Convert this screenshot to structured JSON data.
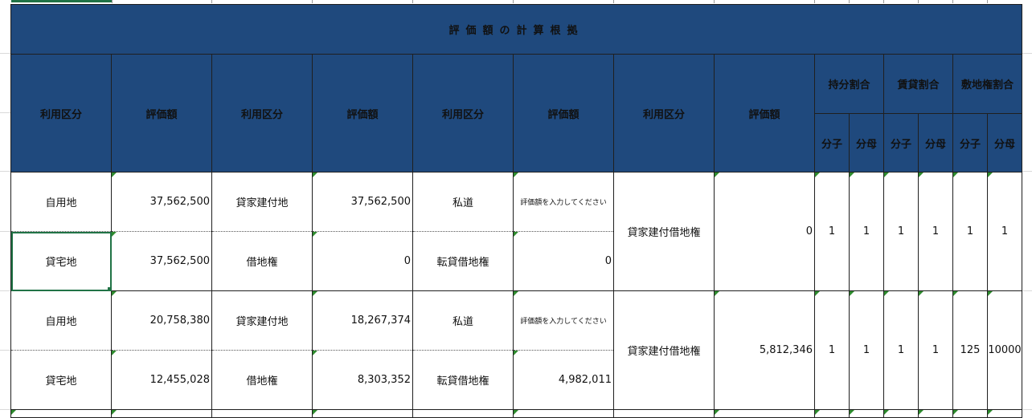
{
  "sheet": {
    "title": "評価額の計算根拠",
    "headers": {
      "col1": "利用区分",
      "col2": "評価額",
      "col3": "利用区分",
      "col4": "評価額",
      "col5": "利用区分",
      "col6": "評価額",
      "col7": "利用区分",
      "col8": "評価額",
      "group_share": "持分割合",
      "group_lease": "賃貸割合",
      "group_land": "敷地権割合",
      "numer": "分子",
      "denom": "分母"
    },
    "blocks": [
      {
        "top": {
          "use1": "自用地",
          "val1": "37,562,500",
          "use2": "貸家建付地",
          "val2": "37,562,500",
          "use3": "私道",
          "val3": "評価額を入力してください"
        },
        "bottom": {
          "use1": "貸宅地",
          "val1": "37,562,500",
          "use2": "借地権",
          "val2": "0",
          "use3": "転貸借地権",
          "val3": "0"
        },
        "merged": {
          "use4": "貸家建付借地権",
          "val4": "0",
          "share_n": "1",
          "share_d": "1",
          "lease_n": "1",
          "lease_d": "1",
          "land_n": "1",
          "land_d": "1"
        }
      },
      {
        "top": {
          "use1": "自用地",
          "val1": "20,758,380",
          "use2": "貸家建付地",
          "val2": "18,267,374",
          "use3": "私道",
          "val3": "評価額を入力してください"
        },
        "bottom": {
          "use1": "貸宅地",
          "val1": "12,455,028",
          "use2": "借地権",
          "val2": "8,303,352",
          "use3": "転貸借地権",
          "val3": "4,982,011"
        },
        "merged": {
          "use4": "貸家建付借地権",
          "val4": "5,812,346",
          "share_n": "1",
          "share_d": "1",
          "lease_n": "1",
          "lease_d": "1",
          "land_n": "125",
          "land_d": "10000"
        }
      }
    ]
  }
}
